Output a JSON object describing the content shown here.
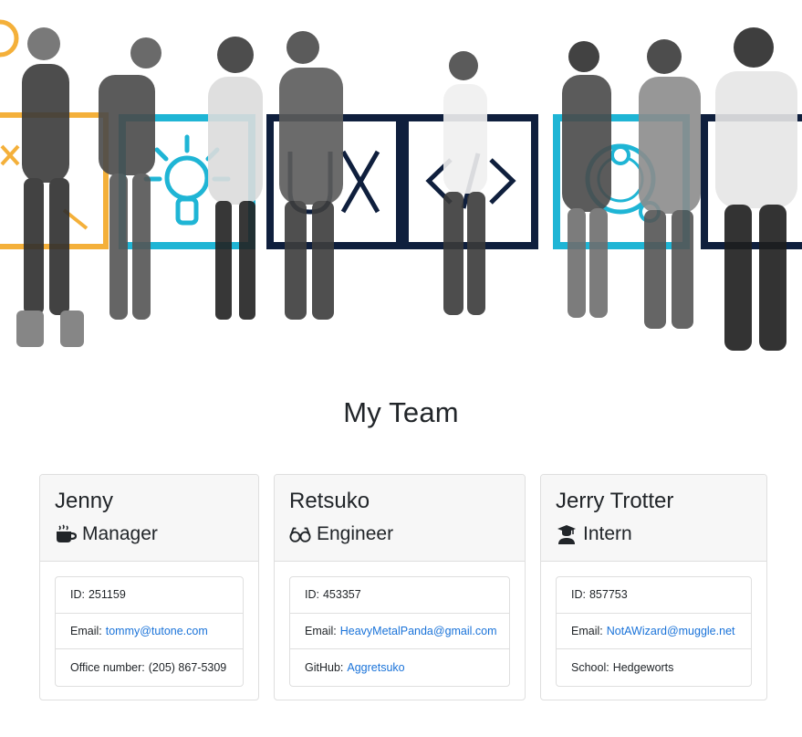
{
  "hero": {
    "icons": [
      "analytics-icon",
      "lightbulb-icon",
      "ux-icon",
      "code-icon",
      "orbit-icon"
    ],
    "ux_text": "UX",
    "code_text": "</>"
  },
  "title": "My Team",
  "colors": {
    "accent_cyan": "#1fb5d5",
    "navy": "#0f1f3d",
    "orange": "#f4b03a",
    "link": "#1a73d9"
  },
  "cards": [
    {
      "name": "Jenny",
      "role": "Manager",
      "role_icon": "coffee-mug-icon",
      "items": [
        {
          "label": "ID:",
          "value": "251159"
        },
        {
          "label": "Email:",
          "value": "tommy@tutone.com",
          "link": true
        },
        {
          "label": "Office number:",
          "value": "(205) 867-5309"
        }
      ]
    },
    {
      "name": "Retsuko",
      "role": "Engineer",
      "role_icon": "glasses-icon",
      "items": [
        {
          "label": "ID:",
          "value": "453357"
        },
        {
          "label": "Email:",
          "value": "HeavyMetalPanda@gmail.com",
          "link": true
        },
        {
          "label": "GitHub:",
          "value": "Aggretsuko",
          "link": true
        }
      ]
    },
    {
      "name": "Jerry Trotter",
      "role": "Intern",
      "role_icon": "graduate-icon",
      "items": [
        {
          "label": "ID:",
          "value": "857753"
        },
        {
          "label": "Email:",
          "value": "NotAWizard@muggle.net",
          "link": true
        },
        {
          "label": "School:",
          "value": "Hedgeworts"
        }
      ]
    }
  ]
}
